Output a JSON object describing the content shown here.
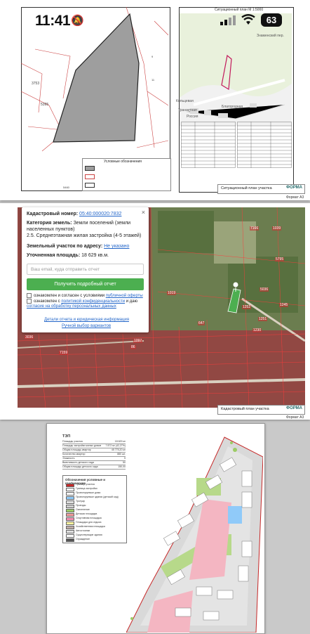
{
  "status_bar": {
    "time": "11:41",
    "battery": "63"
  },
  "page1": {
    "right_title": "Ситуационный план  М 1:5000",
    "map_labels": [
      "Знаменский пер.",
      "Кольцевая",
      "Транзитная",
      "Россия",
      "Благородная"
    ],
    "footer_caption": "Ситуационный план участка",
    "logo": "ФОРМА",
    "format": "Формат А3"
  },
  "popup": {
    "cadastral_label": "Кадастровый номер:",
    "cadastral_value": "05:40:000020:7832",
    "category_label": "Категория земель:",
    "category_value": "Земли поселений (земли",
    "category_value2": "населенных пунктов)",
    "use": "2.5. Среднеэтажная жилая застройка (4-5 этажей)",
    "address_label": "Земельный участок по адресу:",
    "address_value": "Не указано",
    "area_label": "Уточненная площадь:",
    "area_value": "18 629 кв.м.",
    "email_placeholder": "Ваш email, куда отправить отчет",
    "submit": "Получить подробный отчет",
    "check1_pre": "ознакомлен и согласен с условиями",
    "check1_link": "публичной оферты",
    "check2_pre": "ознакомлен с",
    "check2_link": "политикой конфиденциальности",
    "check2_post": "и даю",
    "check2_link2": "согласие на обработку персональных данных",
    "link_details": "Детали отчета и юридическая информация",
    "link_manual": "Ручной выбор вариантов",
    "close": "×"
  },
  "page2": {
    "parcel_labels": [
      "7166",
      "1039",
      "5795",
      "5036",
      "1252",
      "1245",
      "1251",
      "1230",
      "647",
      "1019",
      "3036",
      "7159",
      "1097",
      "86"
    ],
    "footer_caption": "Кадастровый план участка",
    "logo": "ФОРМА",
    "format": "Формат А3"
  },
  "page3": {
    "tep_title": "ТЭП",
    "tep_rows": [
      [
        "Площадь участка",
        "18 629 м²"
      ],
      [
        "Площадь застройки жилых домов",
        "7 872 м² (42,27%)"
      ],
      [
        "Общая площадь квартир",
        "45 775,20 м²"
      ],
      [
        "Количество квартир",
        "880 шт."
      ],
      [
        "Этажность",
        "9"
      ],
      [
        "Вместимость детского сада",
        "50"
      ],
      [
        "Общая площадь детского сада",
        "150,00"
      ]
    ],
    "legend_title": "Обозначения условные и графические",
    "legend_items": [
      [
        "Граница участка",
        "#c62828"
      ],
      [
        "Граница застройки",
        "#ffffff"
      ],
      [
        "Проектируемые дома",
        "#ffffff"
      ],
      [
        "Проектируемые здания (детский сад)",
        "#90caf9"
      ],
      [
        "Тротуар",
        "#e0e0e0"
      ],
      [
        "Проезды",
        "#cfcfcf"
      ],
      [
        "Озеленение",
        "#9ccc65"
      ],
      [
        "Детская площадка",
        "#ef9a9a"
      ],
      [
        "Спортивная площадка",
        "#f48fb1"
      ],
      [
        "Площадка для отдыха",
        "#fff59d"
      ],
      [
        "Хозяйственная площадка",
        "#bcaaa4"
      ],
      [
        "Автостоянки",
        "#e0e0e0"
      ],
      [
        "Существующие здания",
        "#ffffff"
      ],
      [
        "Ограждение",
        "#555555"
      ]
    ]
  }
}
